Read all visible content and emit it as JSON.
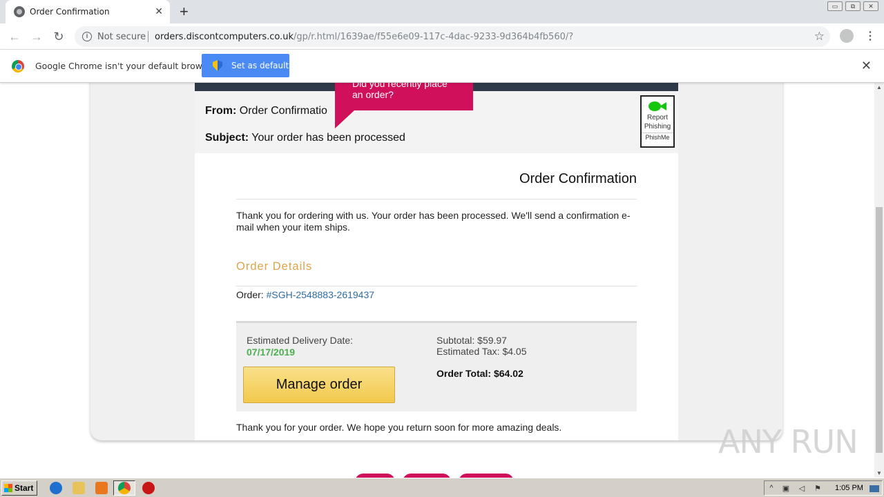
{
  "tab": {
    "title": "Order Confirmation",
    "close": "✕"
  },
  "new_tab": "+",
  "window_buttons": [
    "▭",
    "⧉",
    "✕"
  ],
  "toolbar": {
    "back": "←",
    "forward": "→",
    "reload": "↻",
    "security_label": "Not secure",
    "url_host": "orders.discontcomputers.co.uk",
    "url_path": "/gp/r.html/1639ae/f55e6e09-117c-4dac-9233-9d364b4fb560/?",
    "star": "☆",
    "menu": "⋮"
  },
  "infobar": {
    "message": "Google Chrome isn't your default browser",
    "button_label": "Set as default",
    "close": "✕"
  },
  "email": {
    "from_label": "From:",
    "from_value": "Order Confirmatio",
    "subject_label": "Subject:",
    "subject_value": "Your order has been processed",
    "banner_text": "Did you recently place an order?",
    "report": {
      "line1": "Report",
      "line2": "Phishing",
      "brand": "PhishMe",
      "icon": "fish-icon"
    }
  },
  "order": {
    "title": "Order Confirmation",
    "thanks": "Thank you for ordering with us. Your order has been processed. We'll send a confirmation e-mail when your item ships.",
    "details_heading": "Order Details",
    "order_label": "Order:",
    "order_number": "#SGH-2548883-2619437",
    "delivery_label": "Estimated Delivery Date:",
    "delivery_date": "07/17/2019",
    "manage_button": "Manage order",
    "subtotal": "Subtotal: $59.97",
    "tax": "Estimated Tax: $4.05",
    "total": "Order Total: $64.02",
    "closing": "Thank you for your order. We hope you return soon for more amazing deals."
  },
  "watermark": "ANY RUN",
  "taskbar": {
    "start": "Start",
    "clock": "1:05 PM"
  },
  "colors": {
    "accent_pink": "#d0105a",
    "heading_orange": "#e0a348",
    "date_green": "#4caf50",
    "button_blue": "#4a8af4"
  }
}
